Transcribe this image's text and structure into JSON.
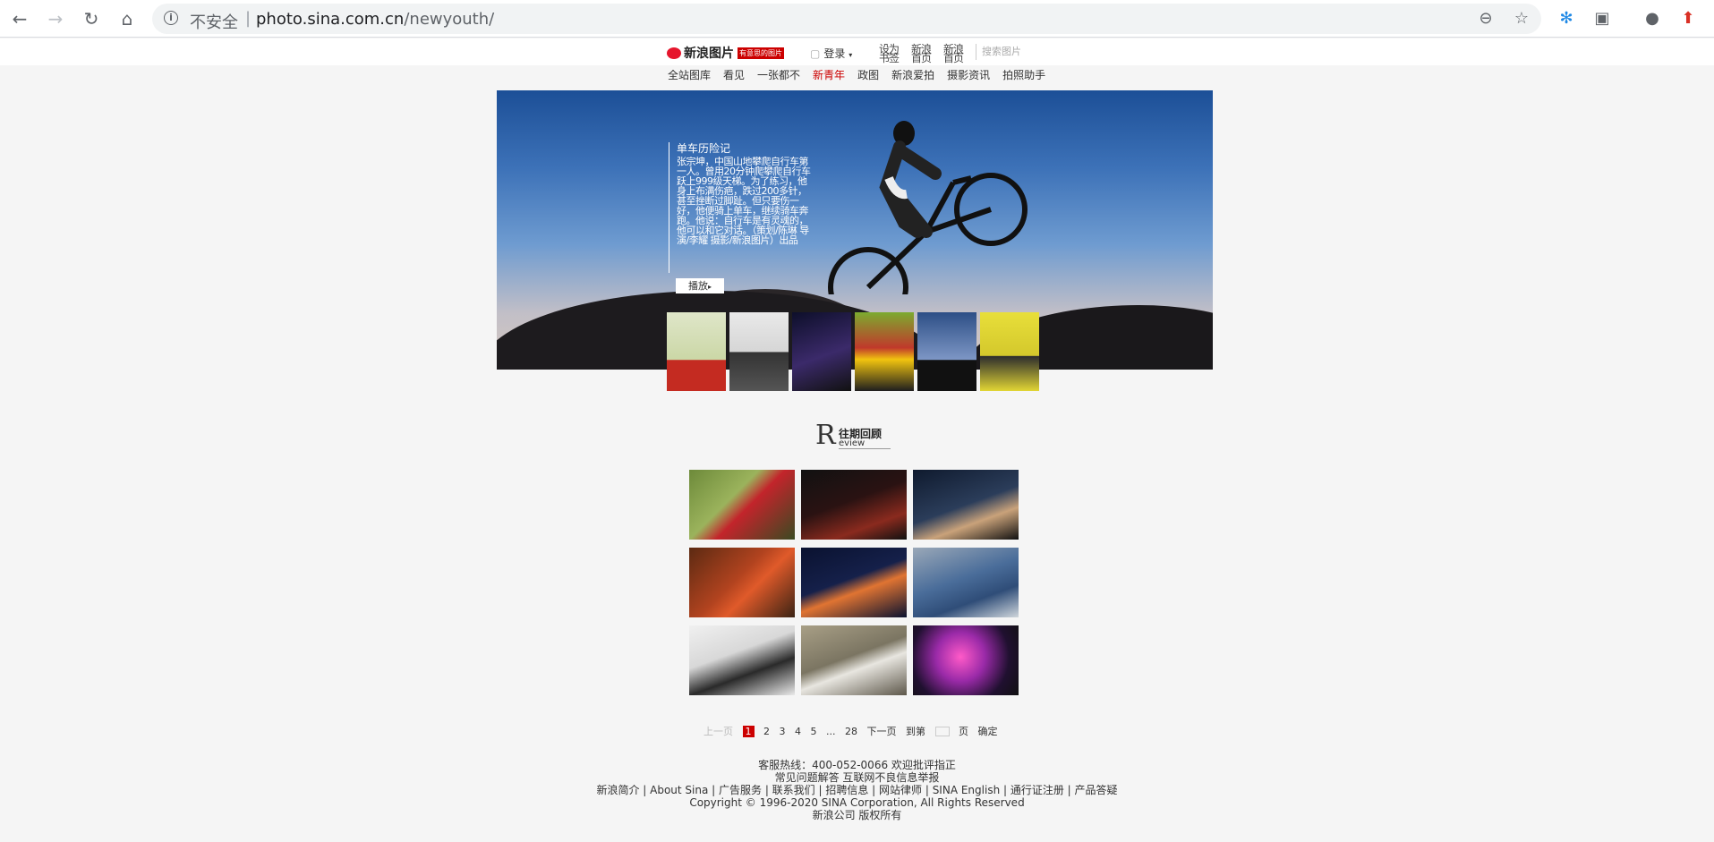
{
  "browser": {
    "security_label": "不安全",
    "url_host": "photo.sina.com.cn",
    "url_path": "/newyouth/"
  },
  "topbar": {
    "logo_text": "新浪图片",
    "logo_tag": "有意思的图片",
    "login": "登录",
    "links": [
      "设为书签",
      "新浪首页",
      "新浪首页"
    ],
    "search_placeholder": "搜索图片"
  },
  "subnav": {
    "items": [
      "全站图库",
      "看见",
      "一张都不",
      "新青年",
      "政图",
      "新浪爱拍",
      "摄影资讯",
      "拍照助手"
    ],
    "current": "新青年"
  },
  "hero": {
    "title": "单车历险记",
    "description": "张宗坤，中国山地攀爬自行车第一人。曾用20分钟爬攀爬自行车跃上999级天梯。为了练习，他身上布满伤疤，跌过200多针，甚至挫断过脚趾。但只要伤一好，他便骑上单车，继续骑车奔跑。他说：自行车是有灵魂的，他可以和它对话。（策划/陈琳 导演/李耀 摄影/新浪图片）出品",
    "play_label": "播放"
  },
  "review": {
    "letter": "R",
    "title": "往期回顾",
    "subtitle": "eview"
  },
  "pager": {
    "prev": "上一页",
    "pages": [
      "1",
      "2",
      "3",
      "4",
      "5",
      "...",
      "28"
    ],
    "current": "1",
    "next": "下一页",
    "goto": "到第",
    "page_unit": "页",
    "confirm": "确定"
  },
  "footer": {
    "line1": "客服热线：400-052-0066 欢迎批评指正",
    "line2": "常见问题解答 互联网不良信息举报",
    "line3": "新浪简介 | About Sina | 广告服务 | 联系我们 | 招聘信息 | 网站律师 | SINA English | 通行证注册 | 产品答疑",
    "line4": "Copyright © 1996-2020 SINA Corporation, All Rights Reserved",
    "line5": "新浪公司 版权所有"
  }
}
